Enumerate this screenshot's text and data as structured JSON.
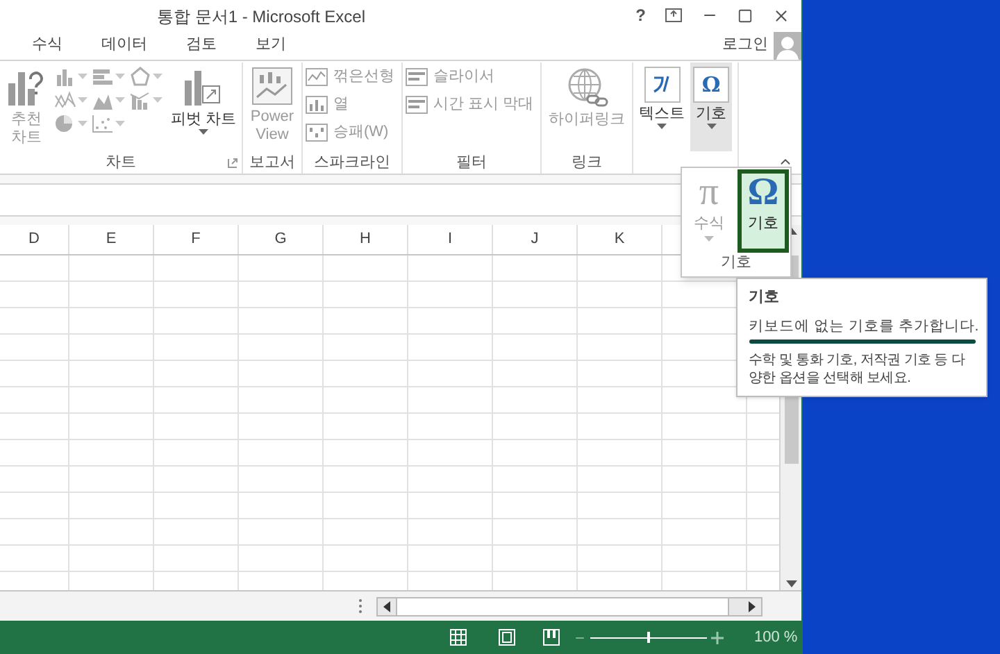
{
  "window": {
    "title": "통합 문서1 - Microsoft Excel",
    "help": "?"
  },
  "tabs": [
    {
      "label": "수식",
      "selected": false
    },
    {
      "label": "데이터",
      "selected": false
    },
    {
      "label": "검토",
      "selected": false
    },
    {
      "label": "보기",
      "selected": false
    }
  ],
  "account": {
    "label": "로그인"
  },
  "ribbon": {
    "groups": [
      {
        "label": "차트",
        "launcher": true,
        "items": [
          {
            "kind": "large",
            "label": "추천 차트",
            "disabled": true,
            "dropdown": false,
            "expanded": false
          },
          {
            "kind": "gallery",
            "disabled": true
          },
          {
            "kind": "large",
            "label": "피벗 차트",
            "disabled": false,
            "dropdown": true,
            "expanded": false
          }
        ]
      },
      {
        "label": "보고서",
        "launcher": false,
        "items": [
          {
            "kind": "large",
            "label": "Power View",
            "disabled": true,
            "dropdown": false,
            "expanded": false
          }
        ]
      },
      {
        "label": "스파크라인",
        "launcher": false,
        "items": [
          {
            "kind": "small",
            "label": "꺾은선형",
            "disabled": true
          },
          {
            "kind": "small",
            "label": "열",
            "disabled": true
          },
          {
            "kind": "small",
            "label": "승패(W)",
            "disabled": true
          }
        ]
      },
      {
        "label": "필터",
        "launcher": false,
        "items": [
          {
            "kind": "small",
            "label": "슬라이서",
            "disabled": true
          },
          {
            "kind": "small",
            "label": "시간 표시 막대",
            "disabled": true
          }
        ]
      },
      {
        "label": "링크",
        "launcher": false,
        "items": [
          {
            "kind": "large",
            "label": "하이퍼링크",
            "disabled": true,
            "dropdown": false,
            "expanded": false
          }
        ]
      },
      {
        "items": [
          {
            "kind": "large",
            "label": "텍스트",
            "disabled": false,
            "dropdown": true,
            "expanded": false
          },
          {
            "kind": "large",
            "label": "기호",
            "glyph": "Ω",
            "disabled": false,
            "dropdown": true,
            "expanded": true
          }
        ]
      }
    ]
  },
  "columns": [
    "D",
    "E",
    "F",
    "G",
    "H",
    "I",
    "J",
    "K"
  ],
  "symbol_popup": {
    "group_label": "기호",
    "buttons": [
      {
        "glyph": "π",
        "label": "수식",
        "selected": false,
        "disabled": true
      },
      {
        "glyph": "Ω",
        "label": "기호",
        "selected": true,
        "disabled": false
      }
    ]
  },
  "tooltip": {
    "title": "기호",
    "summary": "키보드에 없는 기호를 추가합니다.",
    "detail": "수학 및 통화 기호, 저작권 기호 등 다양한 옵션을 선택해 보세요."
  },
  "status_bar": {
    "zoom": {
      "level": 0.5,
      "reading": "100 %"
    }
  }
}
